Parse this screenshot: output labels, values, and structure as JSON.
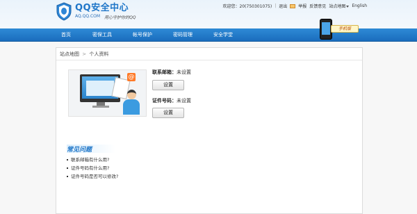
{
  "header": {
    "logo_title": "QQ安全中心",
    "logo_domain": "AQ.QQ.COM",
    "logo_slogan": "用心守护你的QQ"
  },
  "topbar": {
    "welcome": "欢迎您：20(750301075)",
    "logout": "退出",
    "report": "举报",
    "feedback": "反馈意见",
    "sitemap": "站点地图",
    "english": "English"
  },
  "nav": {
    "items": [
      "首页",
      "密保工具",
      "帐号保护",
      "密码管理",
      "安全学堂"
    ]
  },
  "mobile_badge": {
    "label": "手机版"
  },
  "breadcrumb": {
    "home": "站点地图",
    "separator": ">",
    "current": "个人资料"
  },
  "profile": {
    "email_label": "联系邮箱：",
    "email_value": "未设置",
    "email_button": "设置",
    "id_label": "证件号码：",
    "id_value": "未设置",
    "id_button": "设置"
  },
  "faq": {
    "title": "常见问题",
    "items": [
      "联系邮箱有什么用?",
      "证件号码有什么用?",
      "证件号码是否可以修改?"
    ]
  }
}
